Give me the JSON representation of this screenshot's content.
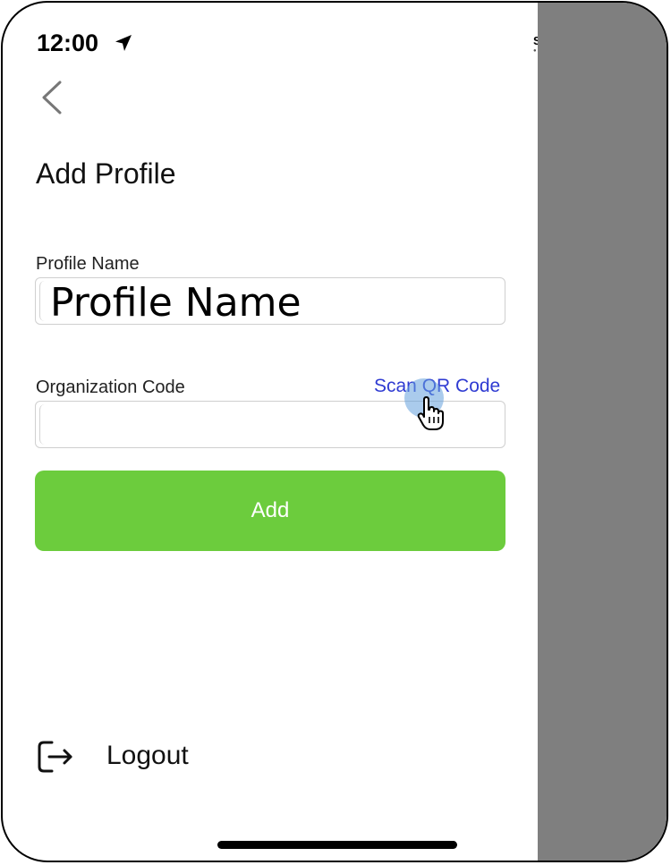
{
  "status_bar": {
    "time": "12:00",
    "sos": "SOS",
    "location_icon": "location-arrow-icon",
    "wifi_icon": "wifi-icon",
    "battery_icon": "battery-icon"
  },
  "nav": {
    "back_icon": "chevron-left-icon"
  },
  "page": {
    "title": "Add Profile"
  },
  "form": {
    "profile_name_label": "Profile Name",
    "profile_name_value": "Profile Name",
    "org_code_label": "Organization Code",
    "org_code_value": "",
    "scan_qr_label": "Scan QR Code",
    "add_button_label": "Add"
  },
  "footer": {
    "logout_label": "Logout",
    "logout_icon": "logout-icon"
  },
  "colors": {
    "accent_green": "#6ccc3d",
    "link_blue": "#2f3bd2",
    "overlay_gray": "#7f7f7f"
  }
}
